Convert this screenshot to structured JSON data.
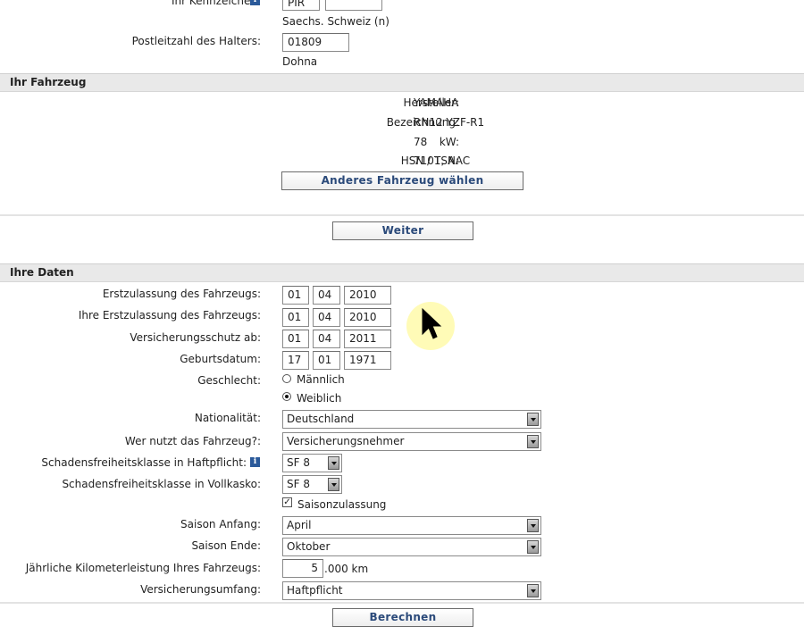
{
  "top": {
    "kennzeichen_label": "Ihr Kennzeichen:",
    "kennzeichen_part1": "PIR",
    "kennzeichen_dash": "-",
    "kennzeichen_part2": "",
    "kennzeichen_region": "Saechs. Schweiz (n)",
    "plz_label": "Postleitzahl des Halters:",
    "plz_value": "01809",
    "plz_city": "Dohna"
  },
  "vehicle": {
    "section_title": "Ihr Fahrzeug",
    "rows": [
      {
        "label": "Hersteller:",
        "value": "YAMAHA"
      },
      {
        "label": "Bezeichnung:",
        "value": "RN12 YZF-R1"
      },
      {
        "label": "kW:",
        "value": "78"
      },
      {
        "label": "HSN / TSN:",
        "value": "7101, AAC"
      }
    ],
    "change_button": "Anderes Fahrzeug wählen"
  },
  "weiter_button": "Weiter",
  "data": {
    "section_title": "Ihre Daten",
    "dates": [
      {
        "label": "Erstzulassung des Fahrzeugs:",
        "day": "01",
        "month": "04",
        "year": "2010"
      },
      {
        "label": "Ihre Erstzulassung des Fahrzeugs:",
        "day": "01",
        "month": "04",
        "year": "2010"
      },
      {
        "label": "Versicherungsschutz ab:",
        "day": "01",
        "month": "04",
        "year": "2011"
      },
      {
        "label": "Geburtsdatum:",
        "day": "17",
        "month": "01",
        "year": "1971"
      }
    ],
    "gender_label": "Geschlecht:",
    "gender_male": "Männlich",
    "gender_female": "Weiblich",
    "gender_selected": "Weiblich",
    "nationality_label": "Nationalität:",
    "nationality_value": "Deutschland",
    "user_label": "Wer nutzt das Fahrzeug?:",
    "user_value": "Versicherungsnehmer",
    "sf_haft_label": "Schadensfreiheitsklasse in Haftpflicht:",
    "sf_haft_value": "SF 8",
    "sf_voll_label": "Schadensfreiheitsklasse in Vollkasko:",
    "sf_voll_value": "SF 8",
    "saison_check_label": "Saisonzulassung",
    "saison_checked": true,
    "saison_start_label": "Saison Anfang:",
    "saison_start_value": "April",
    "saison_end_label": "Saison Ende:",
    "saison_end_value": "Oktober",
    "km_label": "Jährliche Kilometerleistung Ihres Fahrzeugs:",
    "km_value": "5",
    "km_suffix": ".000 km",
    "umfang_label": "Versicherungsumfang:",
    "umfang_value": "Haftpflicht"
  },
  "berechnen_button": "Berechnen",
  "icons": {
    "info": "info-icon",
    "dropdown": "dropdown-arrow-icon",
    "cursor": "mouse-cursor-icon"
  }
}
